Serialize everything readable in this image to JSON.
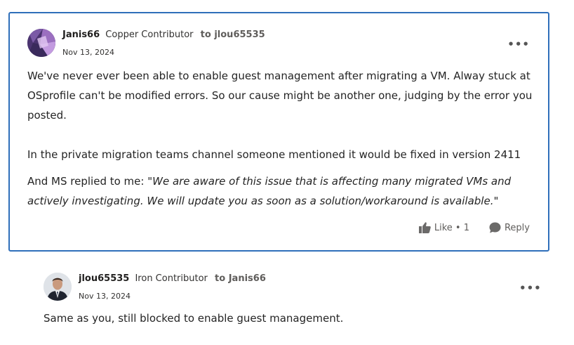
{
  "post1": {
    "author": "Janis66",
    "rank": "Copper Contributor",
    "to": "to jlou65535",
    "date": "Nov 13, 2024",
    "more": "•••",
    "para1": "We've never ever been able to enable guest management after migrating a VM. Alway stuck at OSprofile can't be modified errors. So our cause might be another one, judging by the error you posted.",
    "para2": "In the private migration teams channel someone mentioned it would be fixed in version 2411",
    "para3_prefix": "And MS replied to me: \"",
    "para3_quote": "We are aware of this issue that is affecting many migrated VMs and actively investigating. We will update you as soon as a solution/workaround is available.",
    "para3_suffix": "\"",
    "like_label": "Like • 1",
    "reply_label": "Reply"
  },
  "post2": {
    "author": "jlou65535",
    "rank": "Iron Contributor",
    "to": "to Janis66",
    "date": "Nov 13, 2024",
    "more": "•••",
    "body": "Same as you, still blocked to enable guest management."
  }
}
